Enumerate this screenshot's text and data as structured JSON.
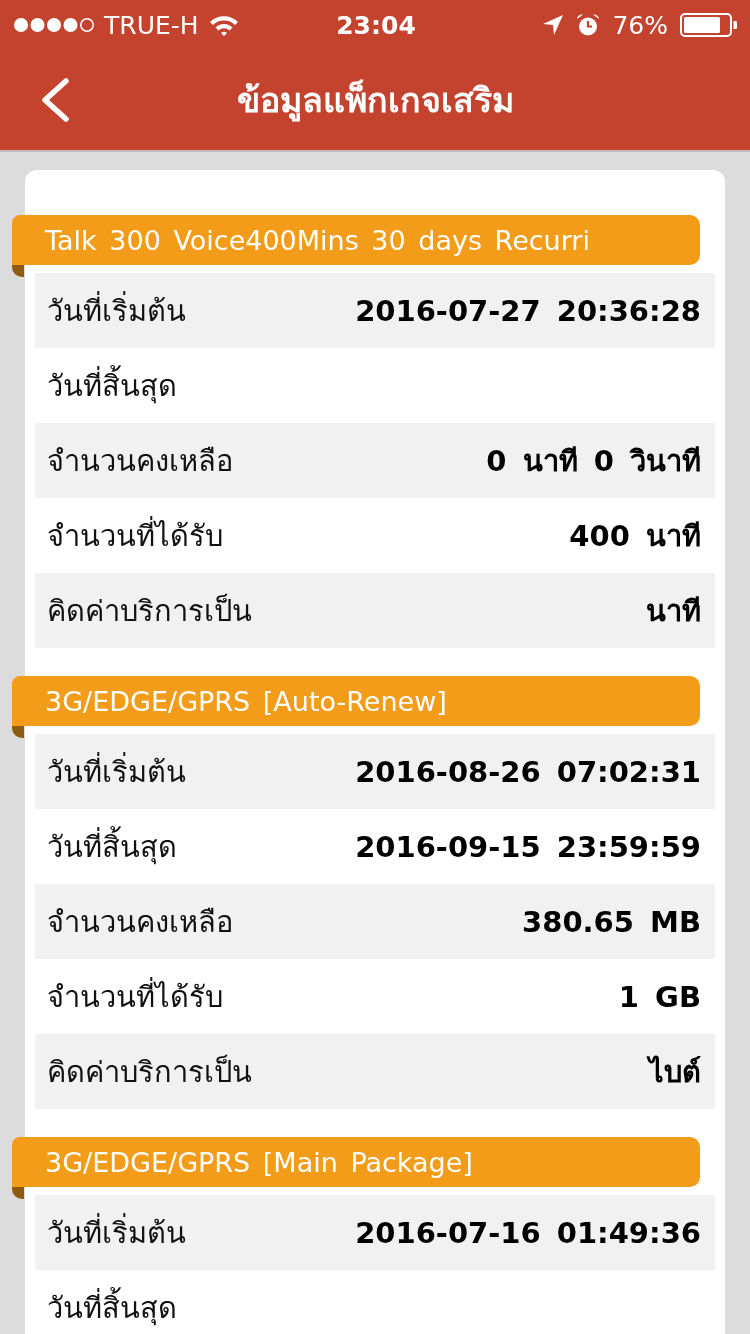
{
  "status_bar": {
    "carrier": "TRUE-H",
    "time": "23:04",
    "battery": "76%"
  },
  "nav_bar": {
    "title": "ข้อมูลแพ็กเกจเสริม"
  },
  "packages": [
    {
      "title": "Talk 300 Voice400Mins 30 days Recurri",
      "rows": [
        {
          "label": "วันที่เริ่มต้น",
          "value": "2016-07-27 20:36:28"
        },
        {
          "label": "วันที่สิ้นสุด"
        },
        {
          "label": "จำนวนคงเหลือ",
          "value": "0 นาที 0 วินาที"
        },
        {
          "label": "จำนวนที่ได้รับ",
          "value": "400 นาที"
        },
        {
          "label": "คิดค่าบริการเป็น",
          "value": "นาที"
        }
      ]
    },
    {
      "title": "3G/EDGE/GPRS [Auto-Renew]",
      "rows": [
        {
          "label": "วันที่เริ่มต้น",
          "value": "2016-08-26 07:02:31"
        },
        {
          "label": "วันที่สิ้นสุด",
          "value": "2016-09-15 23:59:59"
        },
        {
          "label": "จำนวนคงเหลือ",
          "value": "380.65 MB"
        },
        {
          "label": "จำนวนที่ได้รับ",
          "value": "1 GB"
        },
        {
          "label": "คิดค่าบริการเป็น",
          "value": "ไบต์"
        }
      ]
    },
    {
      "title": "3G/EDGE/GPRS [Main Package]",
      "rows": [
        {
          "label": "วันที่เริ่มต้น",
          "value": "2016-07-16 01:49:36"
        },
        {
          "label": "วันที่สิ้นสุด"
        }
      ]
    }
  ]
}
